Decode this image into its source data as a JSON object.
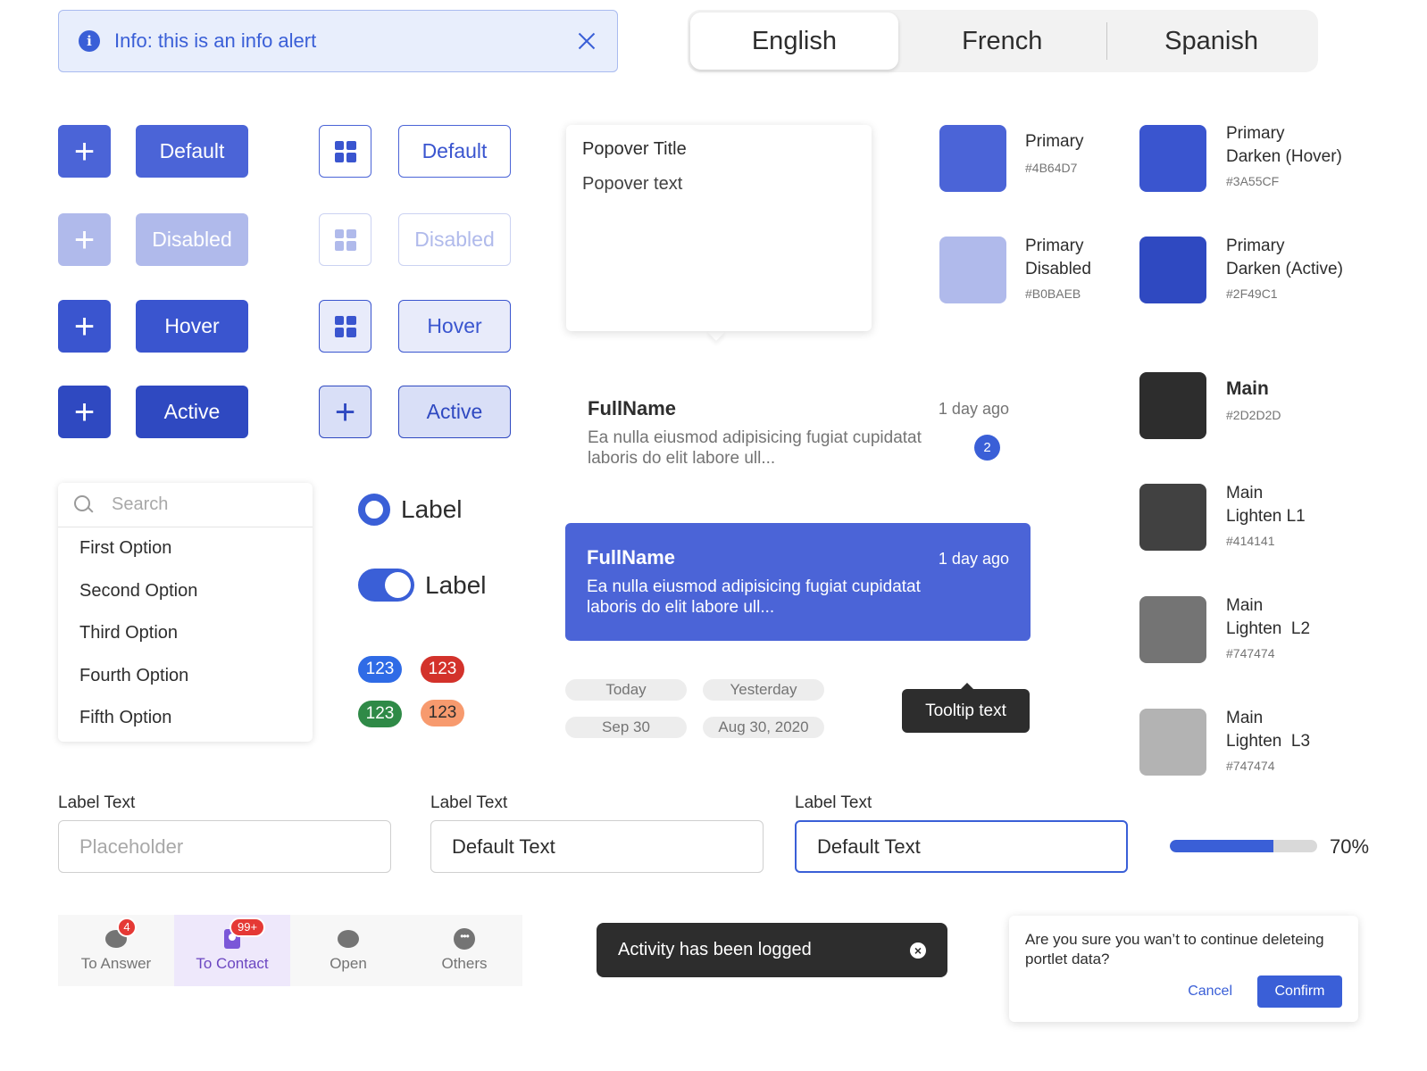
{
  "alert": {
    "text": "Info: this is an info alert",
    "icon": "info-icon"
  },
  "language_switch": {
    "options": [
      "English",
      "French",
      "Spanish"
    ],
    "selected": "English"
  },
  "buttons": {
    "rows": [
      {
        "state": "Default",
        "label": "Default"
      },
      {
        "state": "Disabled",
        "label": "Disabled"
      },
      {
        "state": "Hover",
        "label": "Hover"
      },
      {
        "state": "Active",
        "label": "Active"
      }
    ]
  },
  "popover": {
    "title": "Popover Title",
    "text": "Popover text"
  },
  "swatches": [
    {
      "label_line1": "Primary",
      "label_line2": "",
      "hex": "#4B64D7"
    },
    {
      "label_line1": "Primary",
      "label_line2": "Darken (Hover)",
      "hex": "#3A55CF"
    },
    {
      "label_line1": "Primary",
      "label_line2": "Disabled",
      "hex": "#B0BAEB"
    },
    {
      "label_line1": "Primary",
      "label_line2": "Darken (Active)",
      "hex": "#2F49C1"
    },
    {
      "label_line1": "Main",
      "label_line2": "",
      "hex": "#2D2D2D"
    },
    {
      "label_line1": "Main",
      "label_line2": "Lighten L1",
      "hex": "#414141"
    },
    {
      "label_line1": "Main",
      "label_line2": "Lighten  L2",
      "hex": "#747474"
    },
    {
      "label_line1": "Main",
      "label_line2": "Lighten  L3",
      "hex": "#747474"
    }
  ],
  "swatch_fill_colors": [
    "#4B64D7",
    "#3A55CF",
    "#B0BAEB",
    "#2F49C1",
    "#2D2D2D",
    "#414141",
    "#747474",
    "#B3B3B3"
  ],
  "messages": [
    {
      "name": "FullName",
      "time": "1 day ago",
      "snippet": "Ea nulla eiusmod adipisicing fugiat cupidatat laboris do elit labore ull...",
      "unread": "2",
      "selected": false
    },
    {
      "name": "FullName",
      "time": "1 day ago",
      "snippet": "Ea nulla eiusmod adipisicing fugiat cupidatat laboris do elit labore ull...",
      "selected": true
    }
  ],
  "date_chips": [
    "Today",
    "Yesterday",
    "Sep 30",
    "Aug 30, 2020"
  ],
  "tooltip": {
    "text": "Tooltip text"
  },
  "dropdown": {
    "search_placeholder": "Search",
    "options": [
      "First Option",
      "Second Option",
      "Third Option",
      "Fourth Option",
      "Fifth Option"
    ]
  },
  "radio": {
    "label": "Label",
    "checked": true
  },
  "toggle": {
    "label": "Label",
    "on": true
  },
  "count_badges": [
    {
      "value": "123",
      "color": "#2F6BE6"
    },
    {
      "value": "123",
      "color": "#D3322B"
    },
    {
      "value": "123",
      "color": "#2F8A47"
    },
    {
      "value": "123",
      "color": "#F79A6E"
    }
  ],
  "fields": [
    {
      "label": "Label Text",
      "placeholder": "Placeholder",
      "value": ""
    },
    {
      "label": "Label Text",
      "placeholder": "",
      "value": "Default Text"
    },
    {
      "label": "Label Text",
      "placeholder": "",
      "value": "Default Text",
      "focused": true
    }
  ],
  "progress": {
    "fraction": 0.7,
    "label": "70%"
  },
  "tabbar": {
    "tabs": [
      {
        "label": "To Answer",
        "badge": "4",
        "icon": "chat-bubble-icon"
      },
      {
        "label": "To Contact",
        "badge": "99+",
        "icon": "contact-card-icon",
        "active": true
      },
      {
        "label": "Open",
        "badge": "",
        "icon": "open-chat-icon"
      },
      {
        "label": "Others",
        "badge": "",
        "icon": "more-dots-icon"
      }
    ]
  },
  "toast": {
    "text": "Activity has been logged"
  },
  "dialog": {
    "text": "Are you sure you wan’t to continue deleteing portlet data?",
    "cancel_label": "Cancel",
    "confirm_label": "Confirm"
  },
  "colors": {
    "primary": "#4B64D7",
    "primary_hover": "#3A55CF",
    "primary_disabled": "#B0BAEB",
    "primary_active": "#2F49C1",
    "main": "#2D2D2D"
  }
}
